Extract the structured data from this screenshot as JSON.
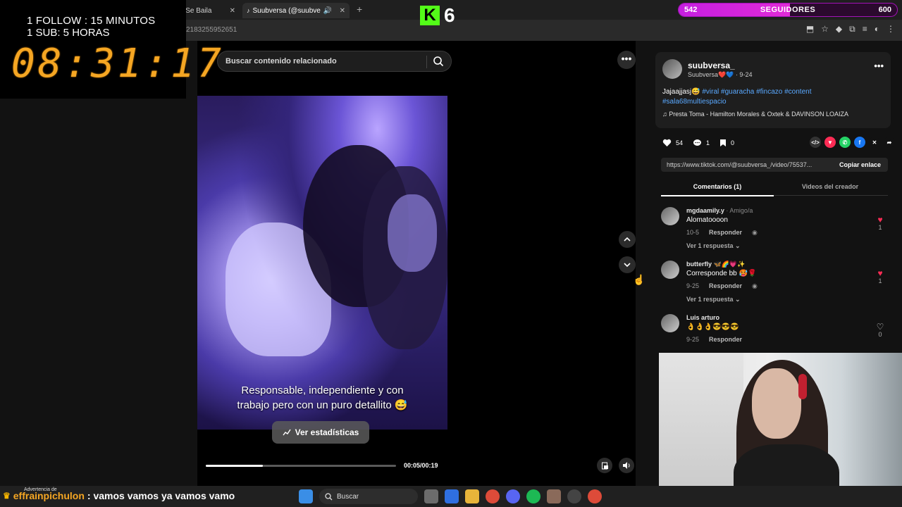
{
  "overlay": {
    "follow_line": "1 FOLLOW : 15 MINUTOS",
    "sub_line": "1 SUB: 5 HORAS",
    "timer": "08:31:17",
    "kick_logo": "K",
    "kick_count": "6"
  },
  "followers": {
    "current": "542",
    "label": "SEGUIDORES",
    "goal": "600",
    "progress": 0.51
  },
  "browser": {
    "tabs": [
      {
        "label": "(ishi - Se Baila"
      },
      {
        "label": "Suubversa (@suubve"
      }
    ],
    "new_tab": "+",
    "url": "2183255952651"
  },
  "tiktok": {
    "search_placeholder": "Buscar contenido relacionado",
    "caption_line1": "Responsable, independiente y con",
    "caption_line2": "trabajo pero con un puro detallito 😅",
    "stats_button": "Ver estadísticas",
    "time": "00:05/00:19",
    "progress": 0.3,
    "more": "•••",
    "author": {
      "name": "suubversa_",
      "subtitle": "Suubversa❤️💙 · 9-24",
      "description_text": "Jajaajjasj😅 ",
      "description_tags": "#viral #guaracha #fincazo #content #sala68multiespacio",
      "music": "♫  Presta Toma - Hamilton Morales & Oxtek & DAVINSON LOAIZA"
    },
    "likes": "54",
    "comments_count": "1",
    "saves": "0",
    "link": "https://www.tiktok.com/@suubversa_/video/75537...",
    "copy_link": "Copiar enlace",
    "tab_comments": "Comentarios (1)",
    "tab_videos": "Videos del creador",
    "comments": [
      {
        "user": "mgdaamily.y",
        "tag": " · Amigo/a",
        "text": "Alomatoooon",
        "date": "10-5",
        "reply": "Responder",
        "replies": "Ver 1 respuesta ⌄",
        "likes": "1",
        "liked": true
      },
      {
        "user": "butterfly 🦋🌈💗✨",
        "tag": "",
        "text": "Corresponde bb 🥵🌹",
        "date": "9-25",
        "reply": "Responder",
        "replies": "Ver 1 respuesta ⌄",
        "likes": "1",
        "liked": true
      },
      {
        "user": "Luis arturo",
        "tag": "",
        "text": "👌👌👌😎😎😎",
        "date": "9-25",
        "reply": "Responder",
        "replies": "",
        "likes": "0",
        "liked": false
      }
    ]
  },
  "chat": {
    "warning": "Advertencia de",
    "user": "effrainpichulon",
    "message": ": vamos vamos ya vamos vamo"
  },
  "taskbar": {
    "search": "Buscar"
  }
}
